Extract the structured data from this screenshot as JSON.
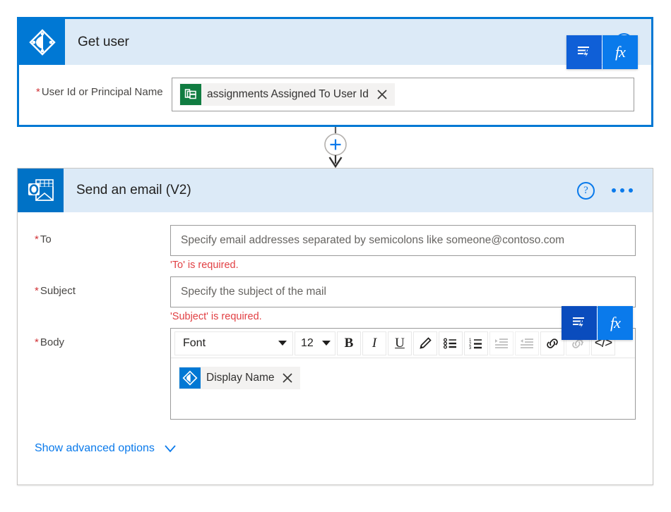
{
  "flow": {
    "cards": [
      {
        "id": "get-user",
        "title": "Get user",
        "connector_icon": "azure-ad-icon",
        "selected": true,
        "fields": [
          {
            "label": "User Id or Principal Name",
            "required_marker": "*",
            "type": "token",
            "token": {
              "icon": "planner-icon",
              "label": "assignments Assigned To User Id"
            }
          }
        ]
      },
      {
        "id": "send-email",
        "title": "Send an email (V2)",
        "connector_icon": "outlook-icon",
        "selected": false,
        "fields": [
          {
            "label": "To",
            "required_marker": "*",
            "type": "text",
            "value": "",
            "placeholder": "Specify email addresses separated by semicolons like someone@contoso.com",
            "error": "'To' is required."
          },
          {
            "label": "Subject",
            "required_marker": "*",
            "type": "text",
            "value": "",
            "placeholder": "Specify the subject of the mail",
            "error": "'Subject' is required."
          },
          {
            "label": "Body",
            "required_marker": "*",
            "type": "richtext",
            "token": {
              "icon": "azure-ad-icon",
              "label": "Display Name"
            }
          }
        ],
        "advanced_options_label": "Show advanced options"
      }
    ]
  },
  "rich_text_toolbar": {
    "font_family_value": "Font",
    "font_size_value": "12",
    "buttons": [
      {
        "name": "bold",
        "glyph": "B"
      },
      {
        "name": "italic",
        "glyph": "I"
      },
      {
        "name": "underline",
        "glyph": "U"
      },
      {
        "name": "text-highlight",
        "glyph": "pen-icon"
      },
      {
        "name": "bulleted-list",
        "glyph": "bullet-list-icon"
      },
      {
        "name": "numbered-list",
        "glyph": "numbered-list-icon"
      },
      {
        "name": "indent",
        "glyph": "indent-icon",
        "disabled": true
      },
      {
        "name": "outdent",
        "glyph": "outdent-icon",
        "disabled": true
      },
      {
        "name": "insert-link",
        "glyph": "link-icon"
      },
      {
        "name": "remove-link",
        "glyph": "unlink-icon",
        "disabled": true
      },
      {
        "name": "code-view",
        "glyph": "</>"
      }
    ]
  },
  "header_actions": {
    "help_glyph": "?",
    "more_commands_label": "..."
  },
  "dynamic_content_popup": {
    "dynamic_content_icon": "dynamic-content-icon",
    "expression_icon": "fx"
  },
  "connector": {
    "add_step_glyph": "+"
  },
  "colors": {
    "accent_blue": "#0078d4",
    "link_blue": "#0a7aeb",
    "error_red": "#e13f43",
    "required_red": "#d13438",
    "header_bg": "#dceaf7",
    "planner_green": "#107c41",
    "outlook_blue": "#0072c6"
  }
}
